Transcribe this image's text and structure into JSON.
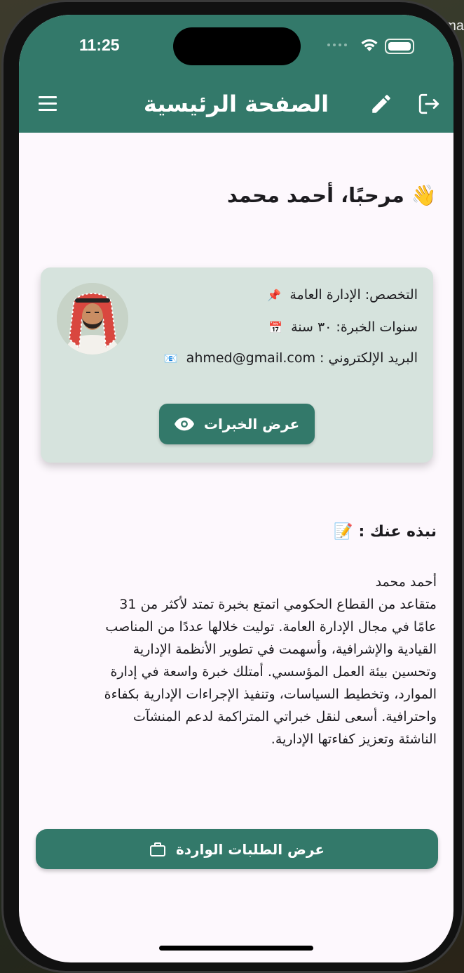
{
  "background": {
    "peek_text": "ma"
  },
  "status_bar": {
    "time": "11:25"
  },
  "app_bar": {
    "title": "الصفحة الرئيسية",
    "icons": [
      "menu-icon",
      "edit-icon",
      "logout-icon"
    ],
    "color": "#33796a"
  },
  "welcome": {
    "text": "👋 مرحبًا، أحمد محمد"
  },
  "profile_card": {
    "specialization": "التخصص: الإدارة العامة",
    "specialization_emoji": "📌",
    "years": "سنوات الخبرة: ٣٠ سنة",
    "years_emoji": "📅",
    "email": "البريد الإلكتروني : ahmed@gmail.com",
    "email_emoji": "📧",
    "show_experience_label": "عرض الخبرات",
    "card_color": "#d6e3dd"
  },
  "about": {
    "title": "نبذه عنك : 📝",
    "text": "أحمد محمد\nمتقاعد من القطاع الحكومي اتمتع بخبرة تمتد لأكثر من 31\nعامًا في مجال الإدارة العامة. توليت خلالها عددًا من المناصب\nالقيادية والإشرافية، وأسهمت في تطوير الأنظمة الإدارية\nوتحسين بيئة العمل المؤسسي. أمتلك خبرة واسعة في إدارة\nالموارد، وتخطيط السياسات، وتنفيذ الإجراءات الإدارية بكفاءة\nواحترافية. أسعى لنقل خبراتي المتراكمة لدعم المنشآت\nالناشئة وتعزيز كفاءتها الإدارية."
  },
  "requests_button": {
    "label": "عرض الطلبات الواردة",
    "icon": "briefcase-icon"
  }
}
